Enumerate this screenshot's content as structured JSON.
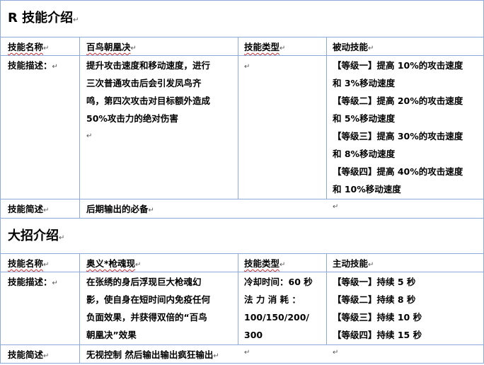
{
  "section1": {
    "title": "R 技能介绍",
    "name_label": "技能名称",
    "name_value": "百鸟朝凰决",
    "type_label": "技能类型",
    "type_value": "被动技能",
    "desc_label": "技能描述：",
    "desc_lines": [
      "提升攻击速度和移动速度，进行",
      "三次普通攻击后会引发凤鸟齐",
      "鸣，第四次攻击对目标额外造成",
      "50%攻击力的绝对伤害"
    ],
    "levels_lines": [
      "【等级一】提高 10%的攻击速度",
      "和 3%移动速度",
      "【等级二】提高 20%的攻击速度",
      "和 5%移动速度",
      "【等级三】提高 30%的攻击速度",
      "和 8%移动速度",
      "【等级四】提高 40%的攻击速度",
      "和 10%移动速度"
    ],
    "brief_label": "技能简述",
    "brief_value": "后期输出的必备"
  },
  "section2": {
    "title": "大招介绍",
    "name_label": "技能名称",
    "name_value": "奥义*枪魂现",
    "type_label": "技能类型",
    "type_value": "主动技能",
    "desc_label": "技能描述：",
    "desc_lines": [
      "在张绣的身后浮现巨大枪魂幻",
      "影，使自身在短时间内免疫任何",
      "负面效果，并获得双倍的“百鸟",
      "朝凰决”效果"
    ],
    "stats_lines": [
      "冷却时间：60 秒",
      "法 力 消 耗 ：",
      "100/150/200/",
      "300"
    ],
    "levels_lines": [
      "【等级一】持续 5 秒",
      "【等级二】持续 8 秒",
      "【等级三】持续 10 秒",
      "【等级四】持续 15 秒"
    ],
    "brief_label": "技能简述",
    "brief_value": "无视控制 然后输出输出疯狂输出"
  },
  "paragraph_mark": "↵",
  "colors": {
    "border": "#8eaadb",
    "spellcheck": "#d03030"
  }
}
